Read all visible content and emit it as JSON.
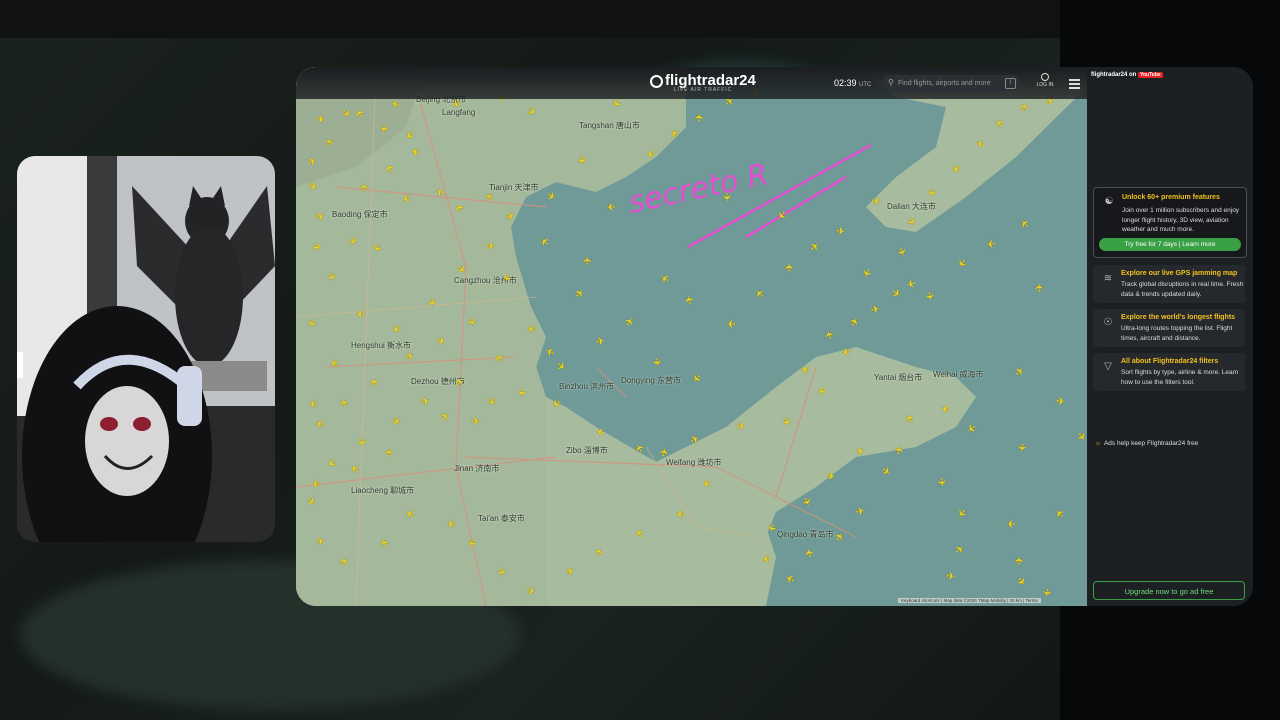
{
  "header": {
    "logo_text": "flightradar24",
    "logo_sub": "LIVE AIR TRAFFIC",
    "time": "02:39",
    "time_zone": "UTC",
    "search_placeholder": "Find flights, airports and more",
    "login_label": "LOG IN"
  },
  "sidebar": {
    "youtube_label": "flightradar24 on",
    "youtube_badge": "YouTube",
    "promo": {
      "title": "Unlock 60+ premium features",
      "description": "Join over 1 million subscribers and enjoy longer flight history, 3D view, aviation weather and much more.",
      "button": "Try free for 7 days | Learn more"
    },
    "cards": [
      {
        "title": "Explore our live GPS jamming map",
        "description": "Track global disruptions in real time. Fresh data & trends updated daily.",
        "icon": "signal-icon"
      },
      {
        "title": "Explore the world's longest flights",
        "description": "Ultra-long routes topping the list. Flight times, aircraft and distance.",
        "icon": "globe-icon"
      },
      {
        "title": "All about Flightradar24 filters",
        "description": "Sort flights by type, airline & more. Learn how to use the filters tool.",
        "icon": "filter-icon"
      }
    ],
    "ads_note": "Ads help keep Flightradar24 free",
    "upgrade_button": "Upgrade now to go ad free"
  },
  "map": {
    "annotation": "secreto R",
    "attribution": "Keyboard shortcuts  |  Map data ©2026 TMap Mobility  |  20 km  |  Terms",
    "cities": [
      {
        "name": "Tangshan",
        "local": "唐山市"
      },
      {
        "name": "Langfang",
        "local": ""
      },
      {
        "name": "Tianjin",
        "local": "天津市"
      },
      {
        "name": "Baoding",
        "local": "保定市"
      },
      {
        "name": "Cangzhou",
        "local": "沧州市"
      },
      {
        "name": "Hengshui",
        "local": "衡水市"
      },
      {
        "name": "Dezhou",
        "local": "德州市"
      },
      {
        "name": "Binzhou",
        "local": "滨州市"
      },
      {
        "name": "Dongying",
        "local": "东营市"
      },
      {
        "name": "Dalian",
        "local": "大连市"
      },
      {
        "name": "Yantai",
        "local": "烟台市"
      },
      {
        "name": "Weihai",
        "local": "威海市"
      },
      {
        "name": "Zibo",
        "local": "淄博市"
      },
      {
        "name": "Weifang",
        "local": "潍坊市"
      },
      {
        "name": "Jinan",
        "local": "济南市"
      },
      {
        "name": "Liaocheng",
        "local": "聊城市"
      },
      {
        "name": "Tai'an",
        "local": "泰安市"
      },
      {
        "name": "Qingdao",
        "local": "青岛市"
      },
      {
        "name": "Beijing",
        "local": "北京市"
      }
    ]
  },
  "colors": {
    "plane": "#f2d61c",
    "accent_green": "#3aa046",
    "annotation": "#e04fd0"
  }
}
